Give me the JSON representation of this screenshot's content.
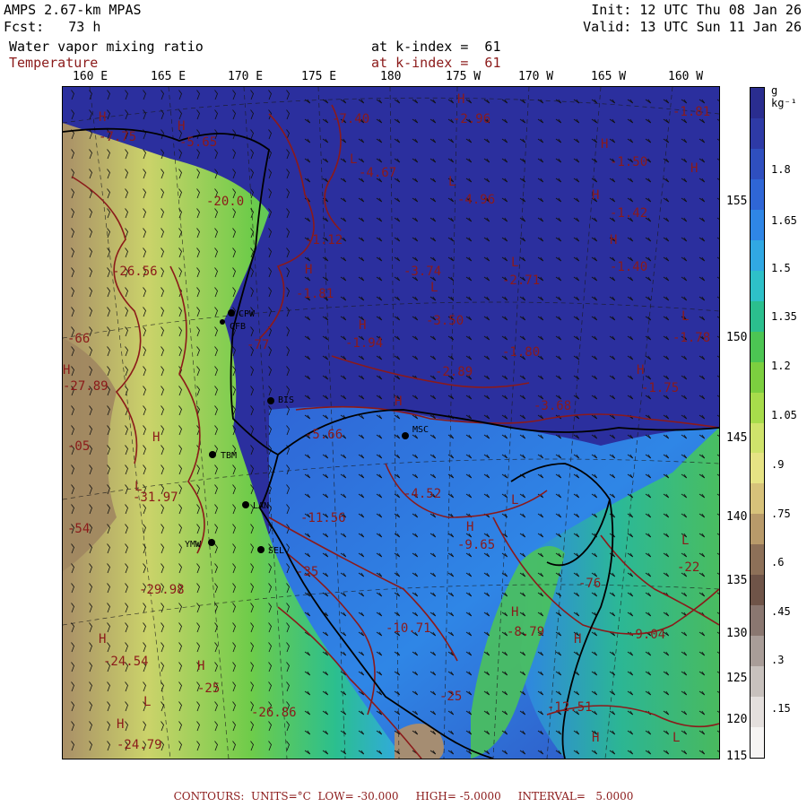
{
  "header": {
    "model": "AMPS 2.67-km MPAS",
    "forecast": "Fcst:   73 h",
    "init": "Init: 12 UTC Thu 08 Jan 26",
    "valid": "Valid: 13 UTC Sun 11 Jan 26",
    "field1": "Water vapor mixing ratio",
    "field1_level": "at k-index =  61",
    "field2": "Temperature",
    "field2_level": "at k-index =  61"
  },
  "lon_labels": [
    "160 E",
    "165 E",
    "170 E",
    "175 E",
    "180",
    "175 W",
    "170 W",
    "165 W",
    "160 W"
  ],
  "lat_labels": [
    "155",
    "150",
    "145",
    "140",
    "135",
    "130",
    "125",
    "120",
    "115"
  ],
  "colorbar": {
    "unit": "g kg⁻¹",
    "labels": [
      "1.8",
      "1.65",
      "1.5",
      "1.35",
      "1.2",
      "1.05",
      ".9",
      ".75",
      ".6",
      ".45",
      ".3",
      ".15"
    ],
    "colors": [
      "#2a2d8f",
      "#2e3aa6",
      "#2f4fbf",
      "#2f66d6",
      "#2f86e6",
      "#31a8e3",
      "#2ec0c8",
      "#2bbf8e",
      "#4cc553",
      "#7ccf3f",
      "#a7dc4b",
      "#cfe36b",
      "#e6e384",
      "#d7c27a",
      "#b89a6a",
      "#8d7058",
      "#6f5448",
      "#8a7770",
      "#a99d98",
      "#c8c1bd",
      "#e4dfdd",
      "#f6f4f3"
    ]
  },
  "stations": [
    {
      "code": "CPW"
    },
    {
      "code": "CFB"
    },
    {
      "code": "BIS"
    },
    {
      "code": "TBM"
    },
    {
      "code": "LAN"
    },
    {
      "code": "YMW"
    },
    {
      "code": "SEL"
    },
    {
      "code": "MSC"
    }
  ],
  "contour_labels": [
    "-7.40",
    "-7.75",
    "-5.65",
    "-20.0",
    "-26.56",
    "-4.67",
    "-4.96",
    "-2.96",
    "-1.81",
    "-1.50",
    "-1.42",
    "-1.40",
    "-1.12",
    "-1.81",
    "-3.74",
    "-2.71",
    "-3.50",
    "-1.94",
    "-2.89",
    "-1.80",
    "-1.78",
    "-1.75",
    "-3.68",
    "-5.66",
    "-4.52",
    "-31.97",
    "-29.98",
    "-24.54",
    "-25",
    "-26.86",
    "-24.79",
    "-9.65",
    "-10.71",
    "-8.79",
    "-9.04",
    "-12.51",
    "-27.89",
    "-22",
    "-35",
    "-54",
    "-05",
    "-66",
    "-77",
    "-25",
    "-76",
    "-11.56"
  ],
  "footer": "CONTOURS:  UNITS=°C  LOW= -30.000     HIGH= -5.0000     INTERVAL=   5.0000"
}
